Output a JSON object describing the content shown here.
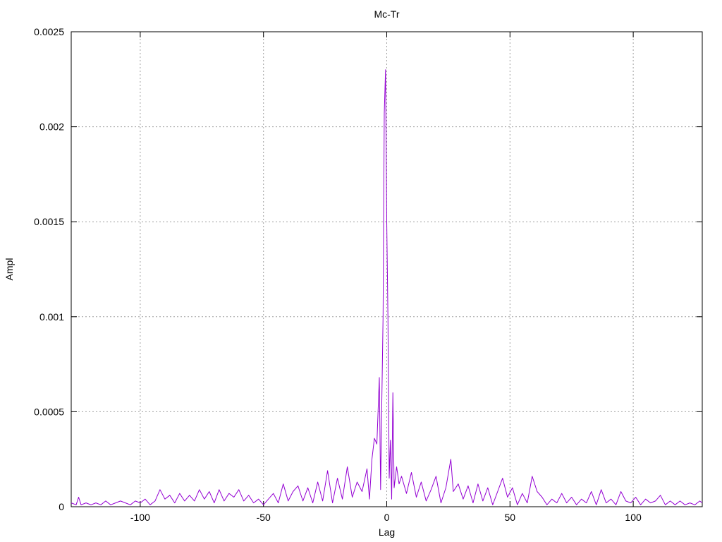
{
  "chart_data": {
    "type": "line",
    "title": "Mc-Tr",
    "xlabel": "Lag",
    "ylabel": "Ampl",
    "xlim": [
      -128,
      128
    ],
    "ylim": [
      0,
      0.0025
    ],
    "x_ticks": [
      {
        "value": -100,
        "label": "-100"
      },
      {
        "value": -50,
        "label": "-50"
      },
      {
        "value": 0,
        "label": "0"
      },
      {
        "value": 50,
        "label": "50"
      },
      {
        "value": 100,
        "label": "100"
      }
    ],
    "y_ticks": [
      {
        "value": 0,
        "label": "0"
      },
      {
        "value": 0.0005,
        "label": "0.0005"
      },
      {
        "value": 0.001,
        "label": "0.001"
      },
      {
        "value": 0.0015,
        "label": "0.0015"
      },
      {
        "value": 0.002,
        "label": "0.002"
      },
      {
        "value": 0.0025,
        "label": "0.0025"
      }
    ],
    "grid": true,
    "line_color": "#9400d3",
    "series": [
      {
        "points": [
          [
            -128,
            2e-05
          ],
          [
            -126,
            1e-05
          ],
          [
            -125,
            5e-05
          ],
          [
            -124,
            1e-05
          ],
          [
            -122,
            2e-05
          ],
          [
            -120,
            1e-05
          ],
          [
            -118,
            2e-05
          ],
          [
            -116,
            1e-05
          ],
          [
            -114,
            3e-05
          ],
          [
            -112,
            1e-05
          ],
          [
            -110,
            2e-05
          ],
          [
            -108,
            3e-05
          ],
          [
            -106,
            2e-05
          ],
          [
            -104,
            1e-05
          ],
          [
            -102,
            3e-05
          ],
          [
            -100,
            2e-05
          ],
          [
            -98,
            4e-05
          ],
          [
            -96,
            1e-05
          ],
          [
            -94,
            3e-05
          ],
          [
            -92,
            9e-05
          ],
          [
            -90,
            4e-05
          ],
          [
            -88,
            6e-05
          ],
          [
            -86,
            2e-05
          ],
          [
            -84,
            7e-05
          ],
          [
            -82,
            3e-05
          ],
          [
            -80,
            6e-05
          ],
          [
            -78,
            3e-05
          ],
          [
            -76,
            9e-05
          ],
          [
            -74,
            4e-05
          ],
          [
            -72,
            8e-05
          ],
          [
            -70,
            2e-05
          ],
          [
            -68,
            9e-05
          ],
          [
            -66,
            3e-05
          ],
          [
            -64,
            7e-05
          ],
          [
            -62,
            5e-05
          ],
          [
            -60,
            9e-05
          ],
          [
            -58,
            3e-05
          ],
          [
            -56,
            6e-05
          ],
          [
            -54,
            2e-05
          ],
          [
            -52,
            4e-05
          ],
          [
            -50,
            1e-05
          ],
          [
            -48,
            4e-05
          ],
          [
            -46,
            7e-05
          ],
          [
            -44,
            2e-05
          ],
          [
            -42,
            0.00012
          ],
          [
            -40,
            3e-05
          ],
          [
            -38,
            8e-05
          ],
          [
            -36,
            0.00011
          ],
          [
            -34,
            3e-05
          ],
          [
            -32,
            0.0001
          ],
          [
            -30,
            2e-05
          ],
          [
            -28,
            0.00013
          ],
          [
            -26,
            3e-05
          ],
          [
            -24,
            0.00019
          ],
          [
            -22,
            2e-05
          ],
          [
            -20,
            0.00015
          ],
          [
            -18,
            4e-05
          ],
          [
            -16,
            0.00021
          ],
          [
            -14,
            5e-05
          ],
          [
            -12,
            0.00013
          ],
          [
            -10,
            8e-05
          ],
          [
            -8,
            0.0002
          ],
          [
            -7,
            4e-05
          ],
          [
            -6,
            0.00025
          ],
          [
            -5,
            0.00036
          ],
          [
            -4,
            0.00033
          ],
          [
            -3,
            0.00068
          ],
          [
            -2.5,
            9e-05
          ],
          [
            -2,
            0.00055
          ],
          [
            -1.5,
            0.001
          ],
          [
            -1,
            0.00207
          ],
          [
            -0.5,
            0.0023
          ],
          [
            0,
            0.0015
          ],
          [
            0.5,
            0.001
          ],
          [
            1,
            0.00015
          ],
          [
            1.5,
            0.00035
          ],
          [
            2,
            4e-05
          ],
          [
            2.5,
            0.0006
          ],
          [
            3,
            0.0001
          ],
          [
            4,
            0.00021
          ],
          [
            5,
            0.00012
          ],
          [
            6,
            0.00016
          ],
          [
            8,
            7e-05
          ],
          [
            10,
            0.00018
          ],
          [
            12,
            5e-05
          ],
          [
            14,
            0.00013
          ],
          [
            16,
            3e-05
          ],
          [
            18,
            9e-05
          ],
          [
            20,
            0.00016
          ],
          [
            22,
            2e-05
          ],
          [
            24,
            0.0001
          ],
          [
            26,
            0.00025
          ],
          [
            27,
            8e-05
          ],
          [
            29,
            0.00012
          ],
          [
            31,
            4e-05
          ],
          [
            33,
            0.00011
          ],
          [
            35,
            2e-05
          ],
          [
            37,
            0.00012
          ],
          [
            39,
            3e-05
          ],
          [
            41,
            0.0001
          ],
          [
            43,
            1e-05
          ],
          [
            45,
            8e-05
          ],
          [
            47,
            0.00015
          ],
          [
            49,
            5e-05
          ],
          [
            51,
            0.0001
          ],
          [
            53,
            1e-05
          ],
          [
            55,
            7e-05
          ],
          [
            57,
            2e-05
          ],
          [
            59,
            0.00016
          ],
          [
            61,
            8e-05
          ],
          [
            63,
            5e-05
          ],
          [
            65,
            1e-05
          ],
          [
            67,
            4e-05
          ],
          [
            69,
            2e-05
          ],
          [
            71,
            7e-05
          ],
          [
            73,
            2e-05
          ],
          [
            75,
            5e-05
          ],
          [
            77,
            1e-05
          ],
          [
            79,
            4e-05
          ],
          [
            81,
            2e-05
          ],
          [
            83,
            8e-05
          ],
          [
            85,
            1e-05
          ],
          [
            87,
            9e-05
          ],
          [
            89,
            2e-05
          ],
          [
            91,
            4e-05
          ],
          [
            93,
            1e-05
          ],
          [
            95,
            8e-05
          ],
          [
            97,
            3e-05
          ],
          [
            99,
            2e-05
          ],
          [
            101,
            5e-05
          ],
          [
            103,
            1e-05
          ],
          [
            105,
            4e-05
          ],
          [
            107,
            2e-05
          ],
          [
            109,
            3e-05
          ],
          [
            111,
            6e-05
          ],
          [
            113,
            1e-05
          ],
          [
            115,
            3e-05
          ],
          [
            117,
            1e-05
          ],
          [
            119,
            3e-05
          ],
          [
            121,
            1e-05
          ],
          [
            123,
            2e-05
          ],
          [
            125,
            1e-05
          ],
          [
            127,
            3e-05
          ],
          [
            128,
            2e-05
          ]
        ]
      }
    ]
  }
}
